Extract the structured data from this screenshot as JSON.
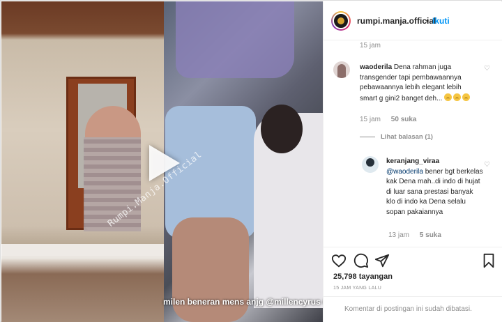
{
  "post": {
    "username": "rumpi.manja.official",
    "separator": "•",
    "follow_label": "Ikuti"
  },
  "media": {
    "watermark": "Rumpi.Manja.Official",
    "caption": "milen beneran mens anjg @millencyrus 😂"
  },
  "comments": {
    "header_time": "15 jam",
    "first": {
      "username": "waoderila",
      "text": "Dena rahman juga transgender tapi pembawaannya pebawaannya lebih elegant lebih smart g gini2 banget deh...",
      "time": "15 jam",
      "likes": "50 suka"
    },
    "view_replies": "Lihat balasan (1)",
    "reply": {
      "username": "keranjang_viraa",
      "mention": "@waoderila",
      "text": "bener bgt berkelas kak Dena mah..di indo di hujat di luar sana prestasi banyak klo di indo ka Dena selalu sopan pakaiannya",
      "time": "13 jam",
      "likes": "5 suka"
    }
  },
  "stats": {
    "views": "25,798 tayangan",
    "posted": "15 JAM YANG LALU",
    "comments_closed": "Komentar di postingan ini sudah dibatasi."
  },
  "icons": {
    "like": "heart-icon",
    "comment": "comment-icon",
    "share": "send-icon",
    "save": "bookmark-icon",
    "play": "play-icon"
  }
}
